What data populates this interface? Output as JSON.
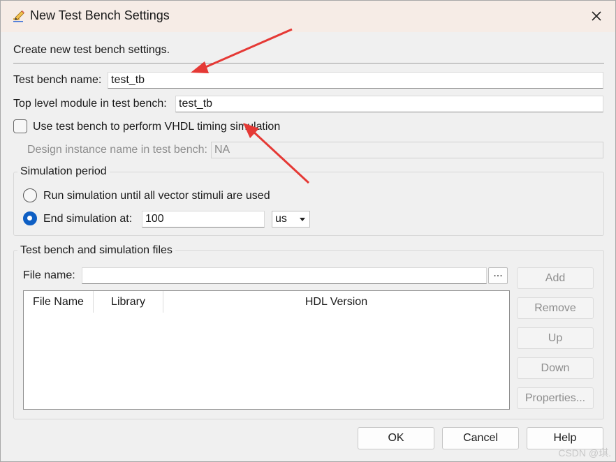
{
  "dialog": {
    "title": "New Test Bench Settings",
    "description": "Create new test bench settings."
  },
  "fields": {
    "test_bench_name_label": "Test bench name:",
    "test_bench_name_value": "test_tb",
    "top_level_label": "Top level module in test bench:",
    "top_level_value": "test_tb",
    "timing_checkbox_label": "Use test bench to perform VHDL timing simulation",
    "timing_checkbox_checked": false,
    "design_instance_label": "Design instance name in test bench:",
    "design_instance_value": "NA"
  },
  "simulation_period": {
    "group_label": "Simulation period",
    "option_all_vectors": "Run simulation until all vector stimuli are used",
    "option_end_at": "End simulation at:",
    "selected": "end_at",
    "end_value": "100",
    "unit": "us"
  },
  "files": {
    "group_label": "Test bench and simulation files",
    "file_name_label": "File name:",
    "file_name_value": "",
    "browse_label": "...",
    "columns": [
      "File Name",
      "Library",
      "HDL Version"
    ],
    "rows": [],
    "side_buttons": [
      "Add",
      "Remove",
      "Up",
      "Down",
      "Properties..."
    ]
  },
  "footer": {
    "ok": "OK",
    "cancel": "Cancel",
    "help": "Help"
  },
  "watermark": "CSDN @琪.",
  "colors": {
    "title_bar": "#f6ece6",
    "accent": "#0e5fc4",
    "annotation_arrow": "#e53935"
  },
  "icons": {
    "title": "pencil-edit-icon",
    "close": "close-icon",
    "dropdown": "chevron-down-icon"
  }
}
